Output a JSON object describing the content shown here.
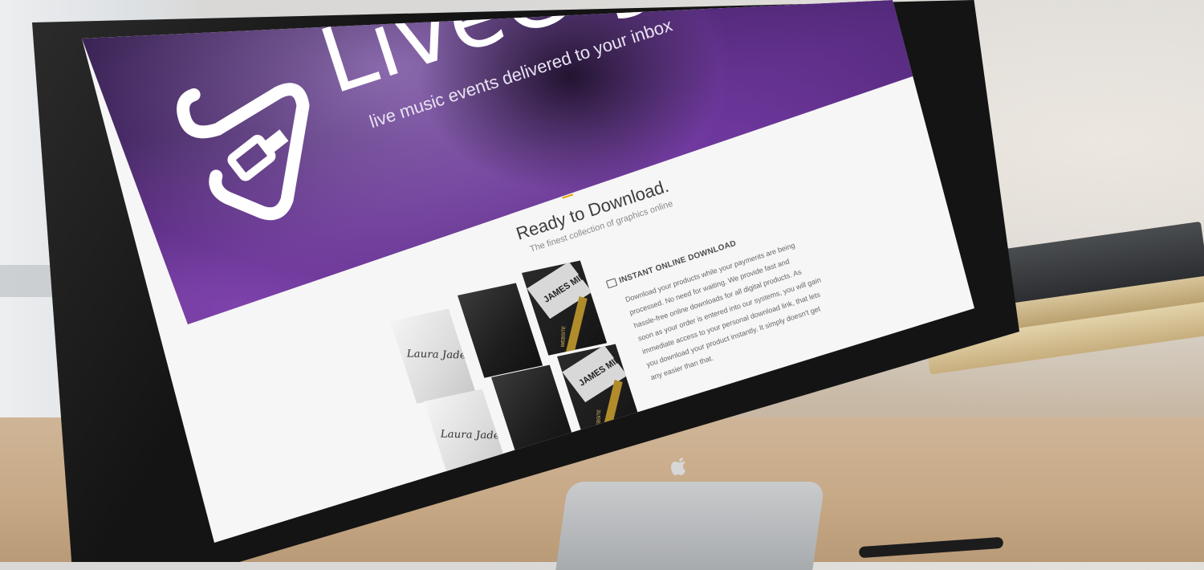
{
  "brand": {
    "name": "LiveGig",
    "tagline": "live music events delivered to your inbox"
  },
  "section": {
    "title": "Ready to Download.",
    "subtitle": "The finest collection of graphics online"
  },
  "info": {
    "heading": "INSTANT ONLINE DOWNLOAD",
    "body": "Download your products while your payments are being processed. No need for waiting. We provide fast and hassle-free online downloads for all digital products. As soon as your order is entered into our systems, you will gain immediate access to your personal download link, that lets you download your product instantly. It simply doesn't get any easier than that."
  },
  "gallery": {
    "cards": [
      {
        "type": "laura",
        "text": "Laura Jade"
      },
      {
        "type": "dark",
        "text": ""
      },
      {
        "type": "james",
        "text": "JAMES MILLER",
        "label": "WEBSITE"
      },
      {
        "type": "laura",
        "text": "Laura Jade"
      },
      {
        "type": "dark",
        "text": ""
      },
      {
        "type": "james",
        "text": "JAMES MILLER",
        "label": "WEBSITE"
      }
    ]
  },
  "colors": {
    "accent": "#e0a800",
    "hero_purple": "#4b2570"
  },
  "icons": [
    "livegig-logo-icon",
    "download-card-icon",
    "apple-logo-icon"
  ]
}
